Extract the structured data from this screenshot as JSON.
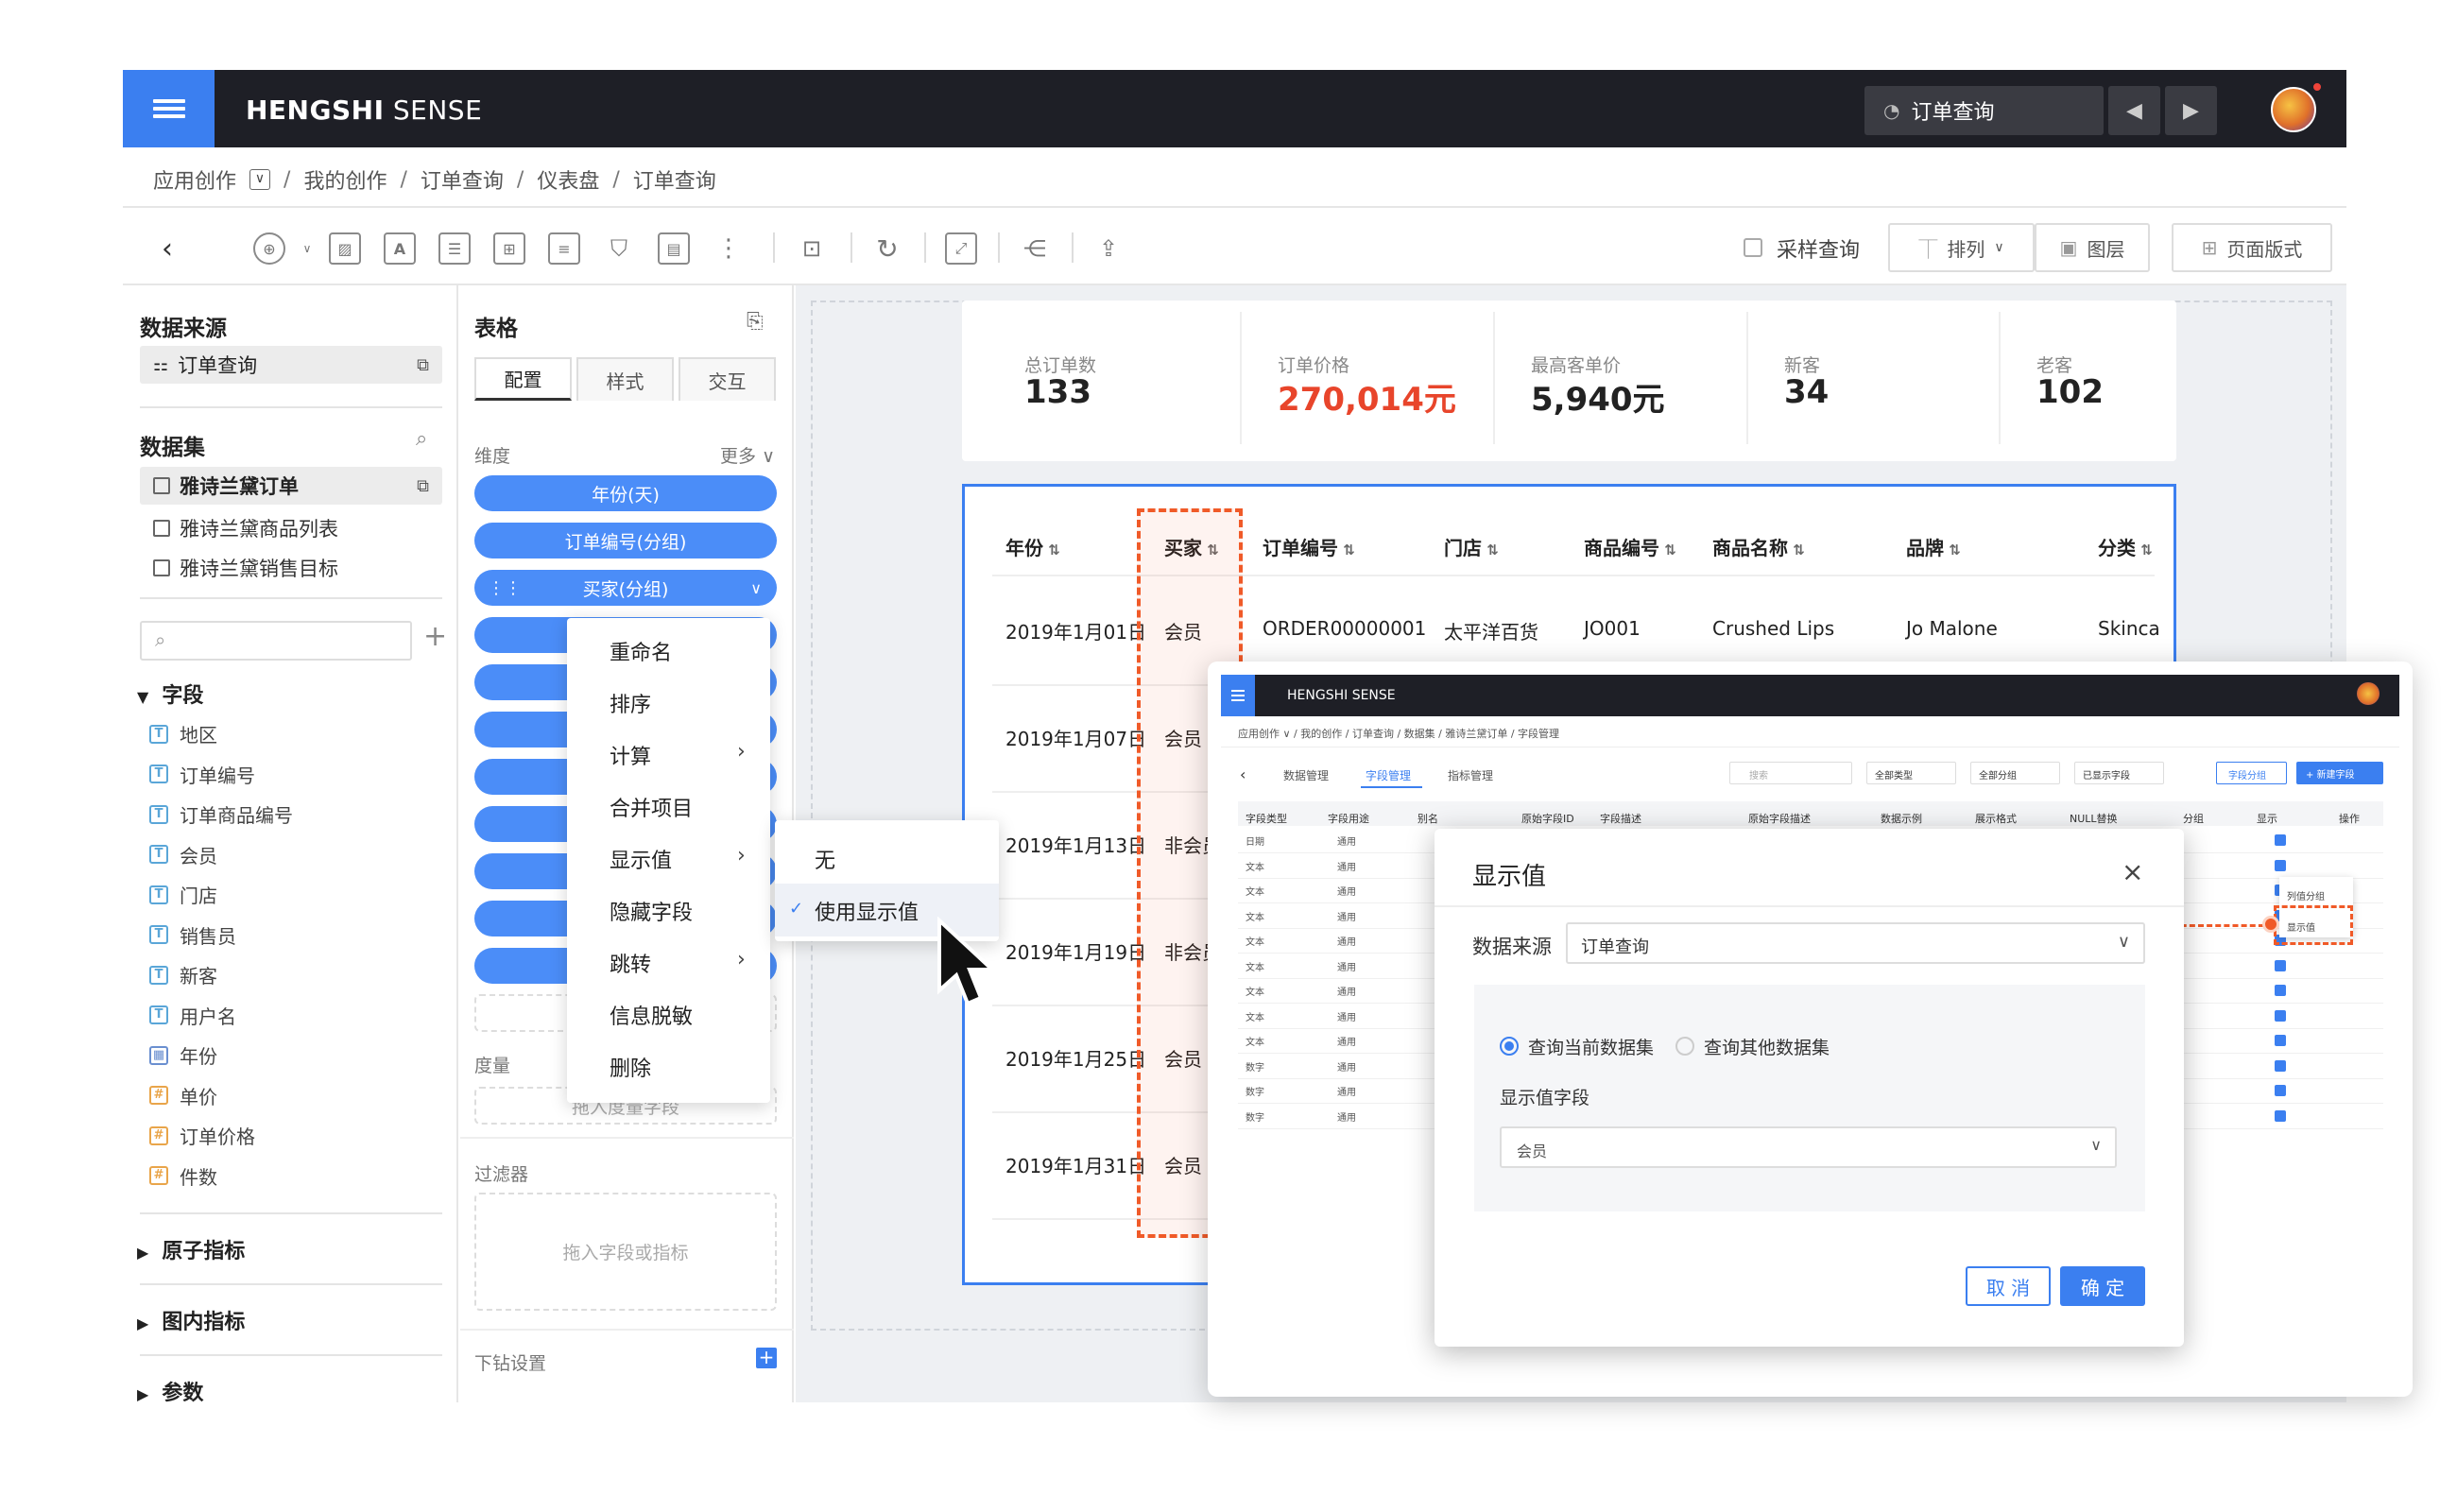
{
  "app": {
    "brand_bold": "HENGSHI",
    "brand_rest": " SENSE",
    "search_text": "订单查询"
  },
  "breadcrumb": [
    "应用创作",
    "我的创作",
    "订单查询",
    "仪表盘",
    "订单查询"
  ],
  "toolbar": {
    "sample_query": "采样查询",
    "arrange": "排列",
    "layers": "图层",
    "page_layout": "页面版式"
  },
  "left_panel": {
    "datasource_title": "数据来源",
    "datasource_item": "订单查询",
    "dataset_title": "数据集",
    "datasets": [
      "雅诗兰黛订单",
      "雅诗兰黛商品列表",
      "雅诗兰黛销售目标"
    ],
    "fields_title": "字段",
    "fields": [
      {
        "icon": "T",
        "name": "地区"
      },
      {
        "icon": "T",
        "name": "订单编号"
      },
      {
        "icon": "T",
        "name": "订单商品编号"
      },
      {
        "icon": "T",
        "name": "会员"
      },
      {
        "icon": "T",
        "name": "门店"
      },
      {
        "icon": "T",
        "name": "销售员"
      },
      {
        "icon": "T",
        "name": "新客"
      },
      {
        "icon": "T",
        "name": "用户名"
      },
      {
        "icon": "date",
        "name": "年份"
      },
      {
        "icon": "#",
        "name": "单价"
      },
      {
        "icon": "#",
        "name": "订单价格"
      },
      {
        "icon": "#",
        "name": "件数"
      }
    ],
    "atomic_metrics": "原子指标",
    "chart_metrics": "图内指标",
    "params": "参数"
  },
  "mid_panel": {
    "title": "表格",
    "tabs": [
      "配置",
      "样式",
      "交互"
    ],
    "dimension_label": "维度",
    "more": "更多",
    "pills": [
      "年份(天)",
      "订单编号(分组)",
      "买家(分组)"
    ],
    "measure_label": "度量",
    "measure_drop": "拖入度量字段",
    "filter_label": "过滤器",
    "filter_drop": "拖入字段或指标",
    "drill_label": "下钻设置"
  },
  "context_menu": {
    "items": [
      "重命名",
      "排序",
      "计算",
      "合并项目",
      "显示值",
      "隐藏字段",
      "跳转",
      "信息脱敏",
      "删除"
    ],
    "submenu": [
      "无",
      "使用显示值"
    ]
  },
  "kpis": [
    {
      "label": "总订单数",
      "value": "133"
    },
    {
      "label": "订单价格",
      "value": "270,014元",
      "color": "#e8452b"
    },
    {
      "label": "最高客单价",
      "value": "5,940元"
    },
    {
      "label": "新客",
      "value": "34"
    },
    {
      "label": "老客",
      "value": "102"
    }
  ],
  "table": {
    "headers": [
      "年份",
      "买家",
      "订单编号",
      "门店",
      "商品编号",
      "商品名称",
      "品牌",
      "分类"
    ],
    "rows": [
      [
        "2019年1月01日",
        "会员",
        "ORDER00000001",
        "太平洋百货",
        "JO001",
        "Crushed Lips",
        "Jo Malone",
        "Skinca"
      ],
      [
        "2019年1月07日",
        "会员"
      ],
      [
        "2019年1月13日",
        "非会员"
      ],
      [
        "2019年1月19日",
        "非会员"
      ],
      [
        "2019年1月25日",
        "会员"
      ],
      [
        "2019年1月31日",
        "会员"
      ]
    ]
  },
  "inset": {
    "brand": "HENGSHI SENSE",
    "crumbs": "应用创作 ∨ / 我的创作 / 订单查询 / 数据集 / 雅诗兰黛订单 / 字段管理",
    "tabs": [
      "数据管理",
      "字段管理",
      "指标管理"
    ],
    "search_placeholder": "搜索",
    "filters": [
      "全部类型",
      "全部分组",
      "已显示字段"
    ],
    "group_btn": "字段分组",
    "new_btn": "+ 新建字段",
    "headers": [
      "字段类型",
      "字段用途",
      "别名",
      "原始字段ID",
      "字段描述",
      "原始字段描述",
      "数据示例",
      "展示格式",
      "NULL替换",
      "分组",
      "显示",
      "操作"
    ],
    "type_rows": [
      "日期",
      "文本",
      "文本",
      "文本",
      "文本",
      "文本",
      "文本",
      "文本",
      "文本",
      "数字",
      "数字",
      "数字"
    ],
    "usage": "通用",
    "popup_items": [
      "列值分组",
      "显示值"
    ]
  },
  "dialog": {
    "title": "显示值",
    "source_label": "数据来源",
    "source_value": "订单查询",
    "radio1": "查询当前数据集",
    "radio2": "查询其他数据集",
    "field_label": "显示值字段",
    "field_value": "会员",
    "cancel": "取 消",
    "ok": "确 定"
  },
  "colors": {
    "accent": "#3b7ff0",
    "highlight": "#f05a28",
    "topbar": "#1e1f26"
  }
}
